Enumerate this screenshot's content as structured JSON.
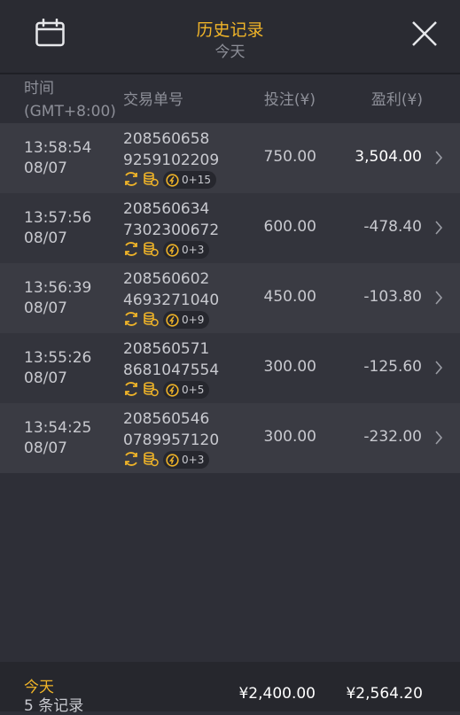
{
  "header": {
    "title": "历史记录",
    "subtitle": "今天"
  },
  "columns": {
    "time_line1": "时间",
    "time_line2": "(GMT+8:00)",
    "order": "交易单号",
    "bet": "投注(¥)",
    "profit": "盈利(¥)"
  },
  "rows": [
    {
      "time": "13:58:54",
      "date": "08/07",
      "order1": "208560658",
      "order2": "9259102209",
      "badge": "0+15",
      "bet": "750.00",
      "profit": "3,504.00"
    },
    {
      "time": "13:57:56",
      "date": "08/07",
      "order1": "208560634",
      "order2": "7302300672",
      "badge": "0+3",
      "bet": "600.00",
      "profit": "-478.40"
    },
    {
      "time": "13:56:39",
      "date": "08/07",
      "order1": "208560602",
      "order2": "4693271040",
      "badge": "0+9",
      "bet": "450.00",
      "profit": "-103.80"
    },
    {
      "time": "13:55:26",
      "date": "08/07",
      "order1": "208560571",
      "order2": "8681047554",
      "badge": "0+5",
      "bet": "300.00",
      "profit": "-125.60"
    },
    {
      "time": "13:54:25",
      "date": "08/07",
      "order1": "208560546",
      "order2": "0789957120",
      "badge": "0+3",
      "bet": "300.00",
      "profit": "-232.00"
    }
  ],
  "footer": {
    "today": "今天",
    "count": "5 条记录",
    "total_bet": "¥2,400.00",
    "total_profit": "¥2,564.20"
  },
  "colors": {
    "accent": "#f0b428",
    "background": "#2e2f37"
  }
}
